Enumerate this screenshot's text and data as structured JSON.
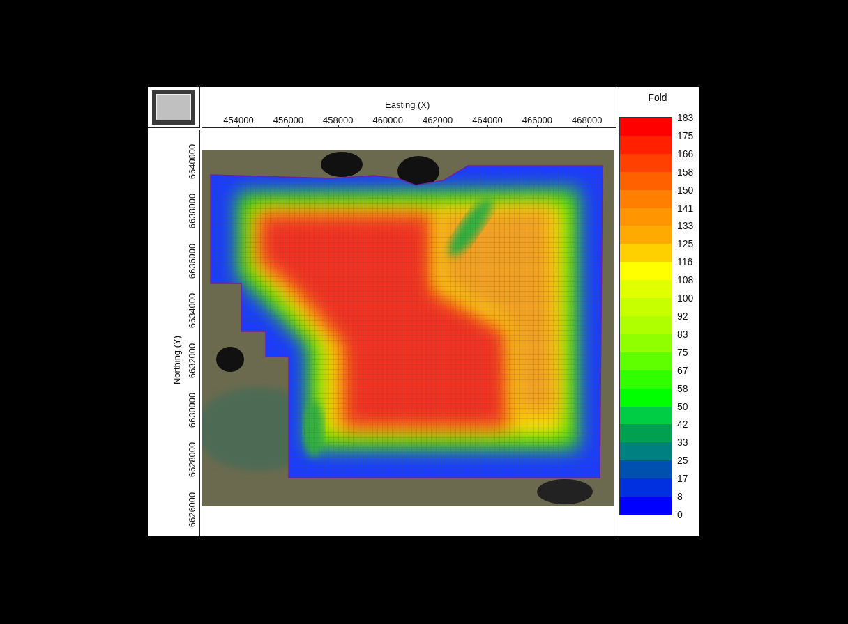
{
  "x_axis": {
    "title": "Easting (X)",
    "ticks": [
      "454000",
      "456000",
      "458000",
      "460000",
      "462000",
      "464000",
      "466000",
      "468000"
    ]
  },
  "y_axis": {
    "title": "Northing (Y)",
    "ticks": [
      "6640000",
      "6638000",
      "6636000",
      "6634000",
      "6632000",
      "6630000",
      "6628000",
      "6626000"
    ]
  },
  "legend": {
    "title": "Fold",
    "labels": [
      "183",
      "175",
      "166",
      "158",
      "150",
      "141",
      "133",
      "125",
      "116",
      "108",
      "100",
      "92",
      "83",
      "75",
      "67",
      "58",
      "50",
      "42",
      "33",
      "25",
      "17",
      "8",
      "0"
    ],
    "bands": [
      {
        "color": "#ff0000"
      },
      {
        "color": "#ff2000"
      },
      {
        "color": "#ff4000"
      },
      {
        "color": "#ff6000"
      },
      {
        "color": "#ff8000"
      },
      {
        "color": "#ff9500"
      },
      {
        "color": "#ffaa00"
      },
      {
        "color": "#ffd000"
      },
      {
        "color": "#ffff00"
      },
      {
        "color": "#e0ff00"
      },
      {
        "color": "#c8ff00"
      },
      {
        "color": "#b0ff00"
      },
      {
        "color": "#90ff00"
      },
      {
        "color": "#60ff00"
      },
      {
        "color": "#30ff00"
      },
      {
        "color": "#00ff00"
      },
      {
        "color": "#00cc44"
      },
      {
        "color": "#00a050"
      },
      {
        "color": "#008080"
      },
      {
        "color": "#0050b0"
      },
      {
        "color": "#0030e0"
      },
      {
        "color": "#0000ff"
      }
    ]
  }
}
